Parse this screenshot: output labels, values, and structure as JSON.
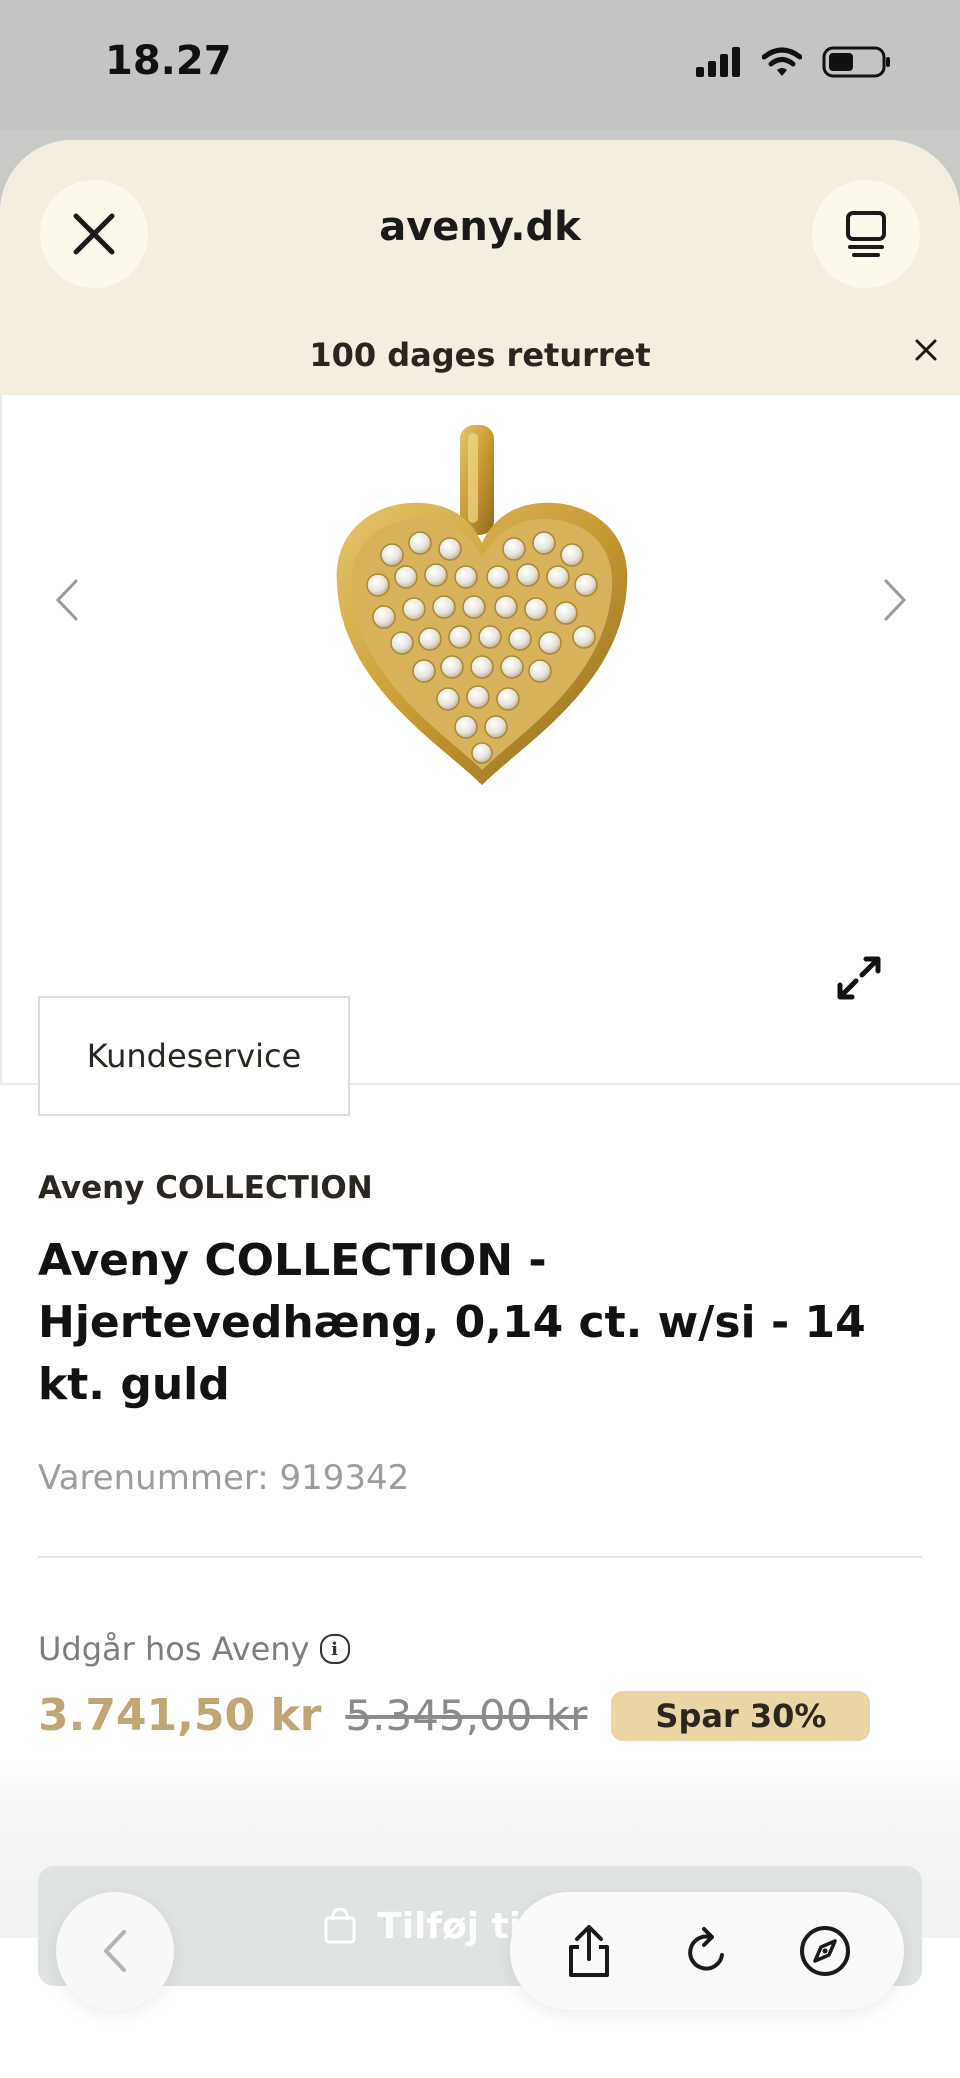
{
  "status_bar": {
    "time": "18.27",
    "icons": [
      "cellular-signal-icon",
      "wifi-icon",
      "battery-icon"
    ]
  },
  "header": {
    "site": "aveny.dk",
    "promo": "100 dages returret",
    "close_icon": "close-icon",
    "menu_icon": "tab-overview-icon"
  },
  "gallery": {
    "image": "gold-heart-pendant",
    "prev_icon": "chevron-left-icon",
    "next_icon": "chevron-right-icon",
    "expand_icon": "expand-icon"
  },
  "customer_service": {
    "label": "Kundeservice"
  },
  "product": {
    "brand": "Aveny COLLECTION",
    "title": "Aveny COLLECTION - Hjertevedhæng, 0,14 ct. w/si - 14 kt. guld",
    "sku": "Varenummer: 919342",
    "availability": "Udgår hos Aveny",
    "price_now": "3.741,50 kr",
    "price_old": "5.345,00 kr",
    "save_badge": "Spar 30%",
    "add_to_cart": "Tilføj til kurv"
  },
  "colors": {
    "header_bg": "#f4eee1",
    "price_accent": "#c0a672",
    "badge_bg": "#e9d6a4"
  },
  "toolbar": {
    "back_icon": "chevron-left-icon",
    "share_icon": "share-icon",
    "reload_icon": "reload-icon",
    "compass_icon": "compass-icon"
  }
}
